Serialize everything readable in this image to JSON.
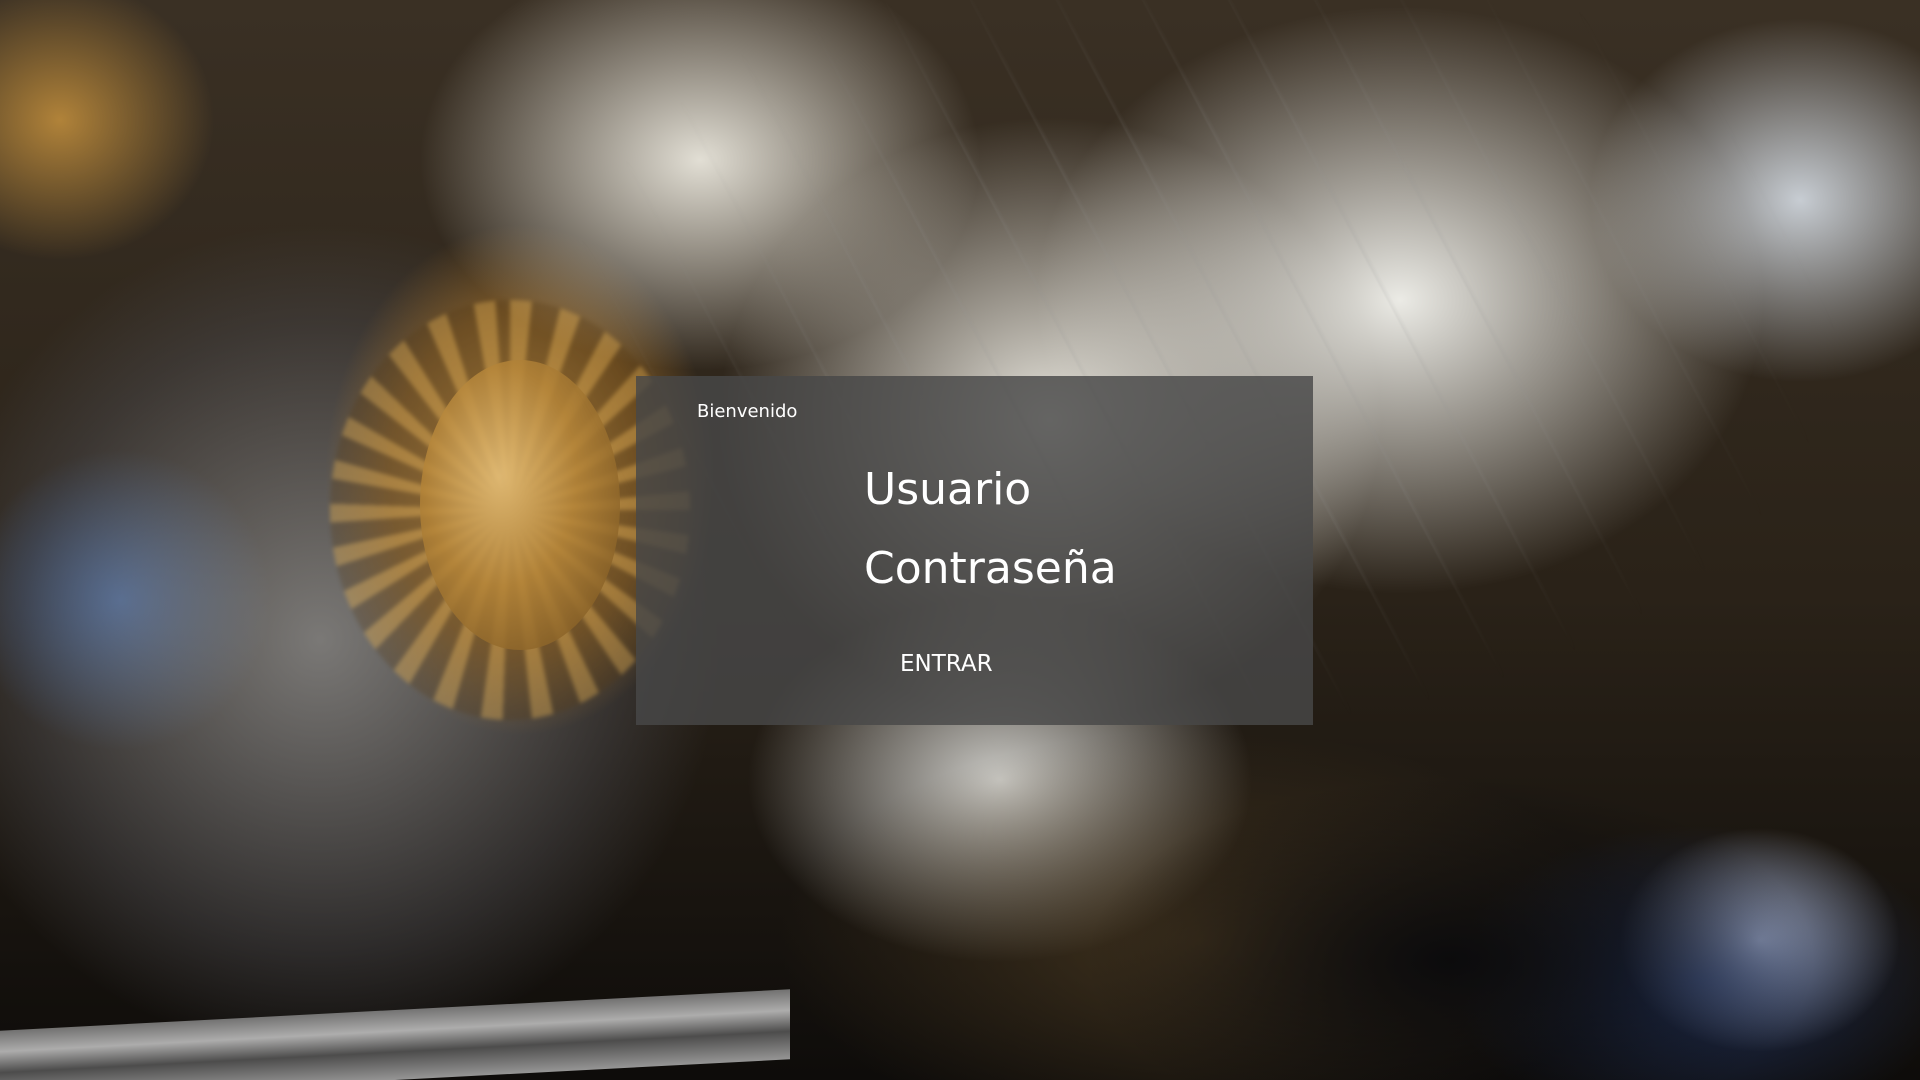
{
  "login": {
    "welcome": "Bienvenido",
    "username_placeholder": "Usuario",
    "password_placeholder": "Contraseña",
    "submit_label": "ENTRAR"
  },
  "colors": {
    "panel_bg": "#484848",
    "text": "#ffffff"
  }
}
